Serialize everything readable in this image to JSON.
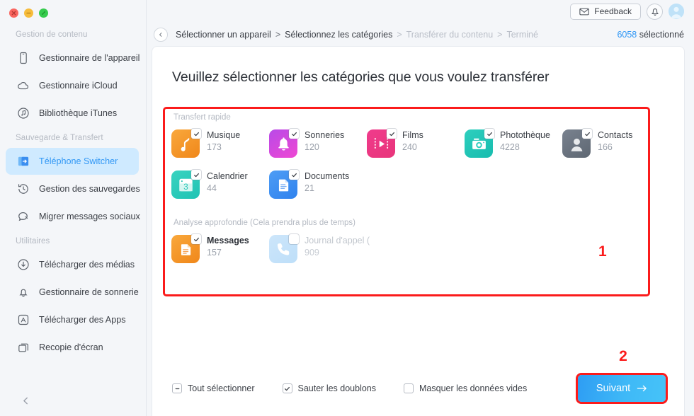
{
  "window": {
    "traffic_lights": [
      "close-button",
      "minimize-button",
      "maximize-button"
    ]
  },
  "sidebar": {
    "groups": [
      {
        "title": "Gestion de contenu",
        "items": [
          {
            "label": "Gestionnaire de l'appareil",
            "icon": "phone-icon",
            "active": false
          },
          {
            "label": "Gestionnaire iCloud",
            "icon": "cloud-icon",
            "active": false
          },
          {
            "label": "Bibliothèque iTunes",
            "icon": "music-circle-icon",
            "active": false
          }
        ]
      },
      {
        "title": "Sauvegarde & Transfert",
        "items": [
          {
            "label": "Téléphone Switcher",
            "icon": "switcher-icon",
            "active": true
          },
          {
            "label": "Gestion des sauvegardes",
            "icon": "history-icon",
            "active": false
          },
          {
            "label": "Migrer messages sociaux",
            "icon": "chat-icon",
            "active": false
          }
        ]
      },
      {
        "title": "Utilitaires",
        "items": [
          {
            "label": "Télécharger des médias",
            "icon": "download-circle-icon",
            "active": false
          },
          {
            "label": "Gestionnaire de sonnerie",
            "icon": "bell-icon",
            "active": false
          },
          {
            "label": "Télécharger des Apps",
            "icon": "appstore-icon",
            "active": false
          },
          {
            "label": "Recopie d'écran",
            "icon": "screen-mirror-icon",
            "active": false
          }
        ]
      }
    ],
    "collapse_icon": "chevron-left-icon"
  },
  "topbar": {
    "feedback_label": "Feedback",
    "feedback_icon": "envelope-icon",
    "bell_icon": "bell-icon",
    "avatar_icon": "user-avatar"
  },
  "breadcrumb": {
    "back_icon": "chevron-left-icon",
    "steps": [
      {
        "label": "Sélectionner un appareil",
        "state": "done"
      },
      {
        "label": "Sélectionnez les catégories",
        "state": "current"
      },
      {
        "label": "Transférer du contenu",
        "state": "upcoming"
      },
      {
        "label": "Terminé",
        "state": "upcoming"
      }
    ],
    "separator": ">",
    "selected_count": "6058",
    "selected_suffix": "sélectionné"
  },
  "main": {
    "title": "Veuillez sélectionner les catégories que vous voulez transférer",
    "quick_group_label": "Transfert rapide",
    "deep_group_label": "Analyse approfondie (Cela prendra plus de temps)",
    "quick_rows": [
      [
        {
          "name": "Musique",
          "count": "173",
          "icon": "music-note-icon",
          "checked": true,
          "color": "#f6921e"
        },
        {
          "name": "Sonneries",
          "count": "120",
          "icon": "bell-icon",
          "checked": true,
          "color": "#d13fe0"
        },
        {
          "name": "Films",
          "count": "240",
          "icon": "film-play-icon",
          "checked": true,
          "color": "#ef3d82"
        },
        {
          "name": "Photothèque",
          "count": "4228",
          "icon": "camera-icon",
          "checked": true,
          "color": "#25c4b4"
        },
        {
          "name": "Contacts",
          "count": "166",
          "icon": "person-icon",
          "checked": true,
          "color": "#6b7480"
        }
      ],
      [
        {
          "name": "Calendrier",
          "count": "44",
          "icon": "calendar-icon",
          "checked": true,
          "color": "#2ec7b8"
        },
        {
          "name": "Documents",
          "count": "21",
          "icon": "document-icon",
          "checked": true,
          "color": "#3b8ff0"
        }
      ]
    ],
    "deep_rows": [
      [
        {
          "name": "Messages",
          "count": "157",
          "icon": "message-icon",
          "checked": true,
          "color": "#f6921e",
          "emphasis": true
        },
        {
          "name": "Journal d'appel (",
          "count": "909",
          "icon": "phone-call-icon",
          "checked": false,
          "color": "#8cc6f5",
          "emphasis": false
        }
      ]
    ],
    "annotation_1": "1",
    "annotation_2": "2"
  },
  "footer": {
    "options": [
      {
        "label": "Tout sélectionner",
        "state": "indeterminate"
      },
      {
        "label": "Sauter les doublons",
        "state": "checked"
      },
      {
        "label": "Masquer les données vides",
        "state": "unchecked"
      }
    ],
    "next_label": "Suivant",
    "next_icon": "arrow-right-icon"
  },
  "colors": {
    "accent": "#3097f5",
    "annotation": "#fb1b1b",
    "sidebar_active_bg": "#cfeaff"
  }
}
